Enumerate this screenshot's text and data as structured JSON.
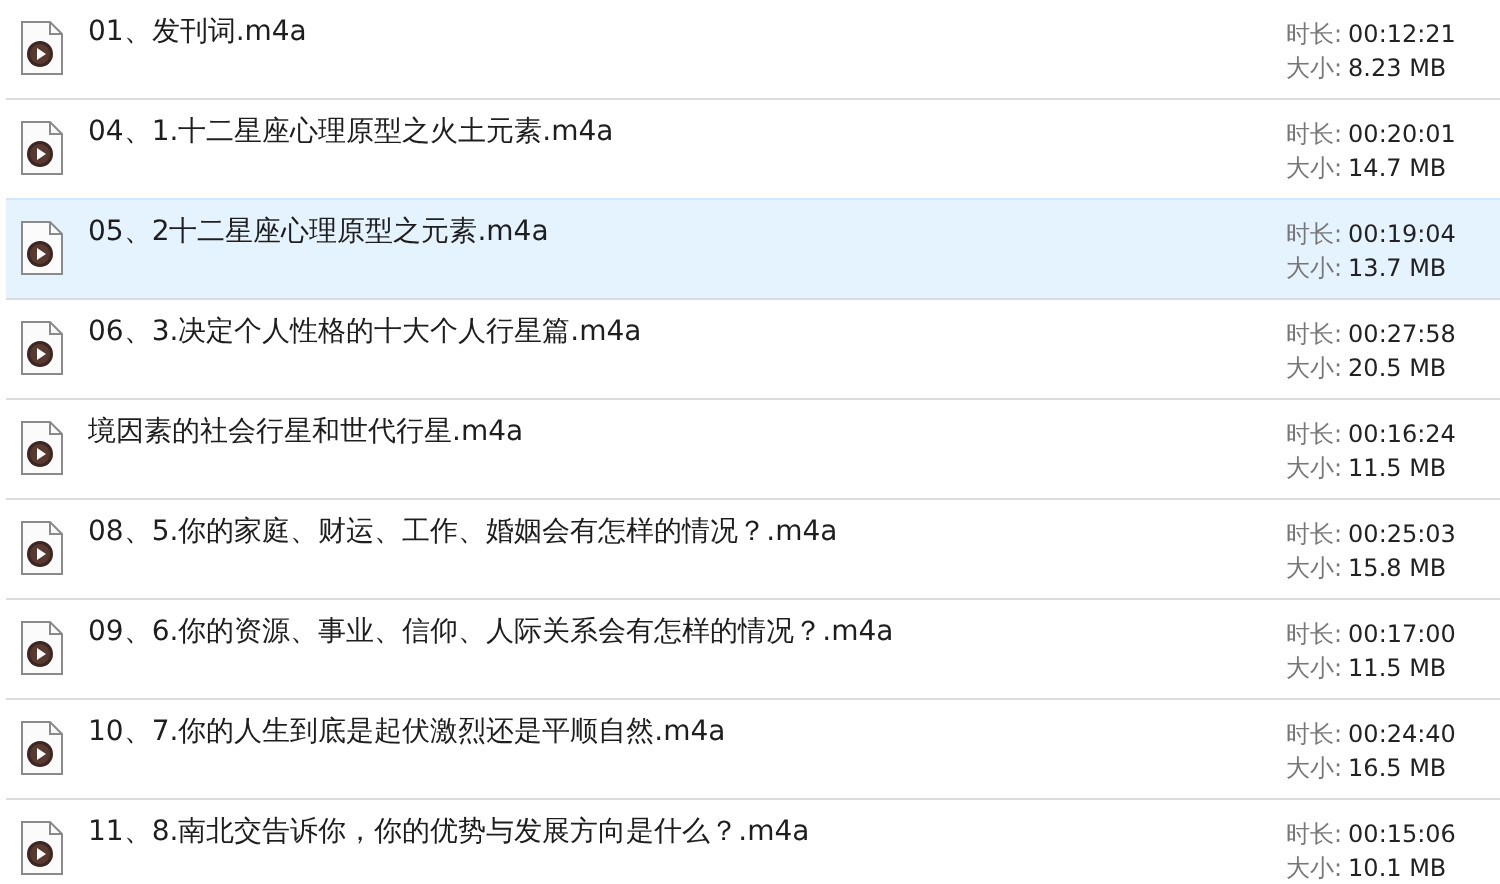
{
  "files": [
    {
      "name": "01、发刊词.m4a",
      "duration_label": "时长:",
      "duration": "00:12:21",
      "size_label": "大小:",
      "size": "8.23 MB",
      "selected": false
    },
    {
      "name": "04、1.十二星座心理原型之火土元素.m4a",
      "duration_label": "时长:",
      "duration": "00:20:01",
      "size_label": "大小:",
      "size": "14.7 MB",
      "selected": false
    },
    {
      "name": "05、2十二星座心理原型之元素.m4a",
      "duration_label": "时长:",
      "duration": "00:19:04",
      "size_label": "大小:",
      "size": "13.7 MB",
      "selected": true
    },
    {
      "name": "06、3.决定个人性格的十大个人行星篇.m4a",
      "duration_label": "时长:",
      "duration": "00:27:58",
      "size_label": "大小:",
      "size": "20.5 MB",
      "selected": false
    },
    {
      "name": "境因素的社会行星和世代行星.m4a",
      "duration_label": "时长:",
      "duration": "00:16:24",
      "size_label": "大小:",
      "size": "11.5 MB",
      "selected": false
    },
    {
      "name": "08、5.你的家庭、财运、工作、婚姻会有怎样的情况？.m4a",
      "duration_label": "时长:",
      "duration": "00:25:03",
      "size_label": "大小:",
      "size": "15.8 MB",
      "selected": false
    },
    {
      "name": "09、6.你的资源、事业、信仰、人际关系会有怎样的情况？.m4a",
      "duration_label": "时长:",
      "duration": "00:17:00",
      "size_label": "大小:",
      "size": "11.5 MB",
      "selected": false
    },
    {
      "name": "10、7.你的人生到底是起伏激烈还是平顺自然.m4a",
      "duration_label": "时长:",
      "duration": "00:24:40",
      "size_label": "大小:",
      "size": "16.5 MB",
      "selected": false
    },
    {
      "name": "11、8.南北交告诉你，你的优势与发展方向是什么？.m4a",
      "duration_label": "时长:",
      "duration": "00:15:06",
      "size_label": "大小:",
      "size": "10.1 MB",
      "selected": false
    }
  ]
}
